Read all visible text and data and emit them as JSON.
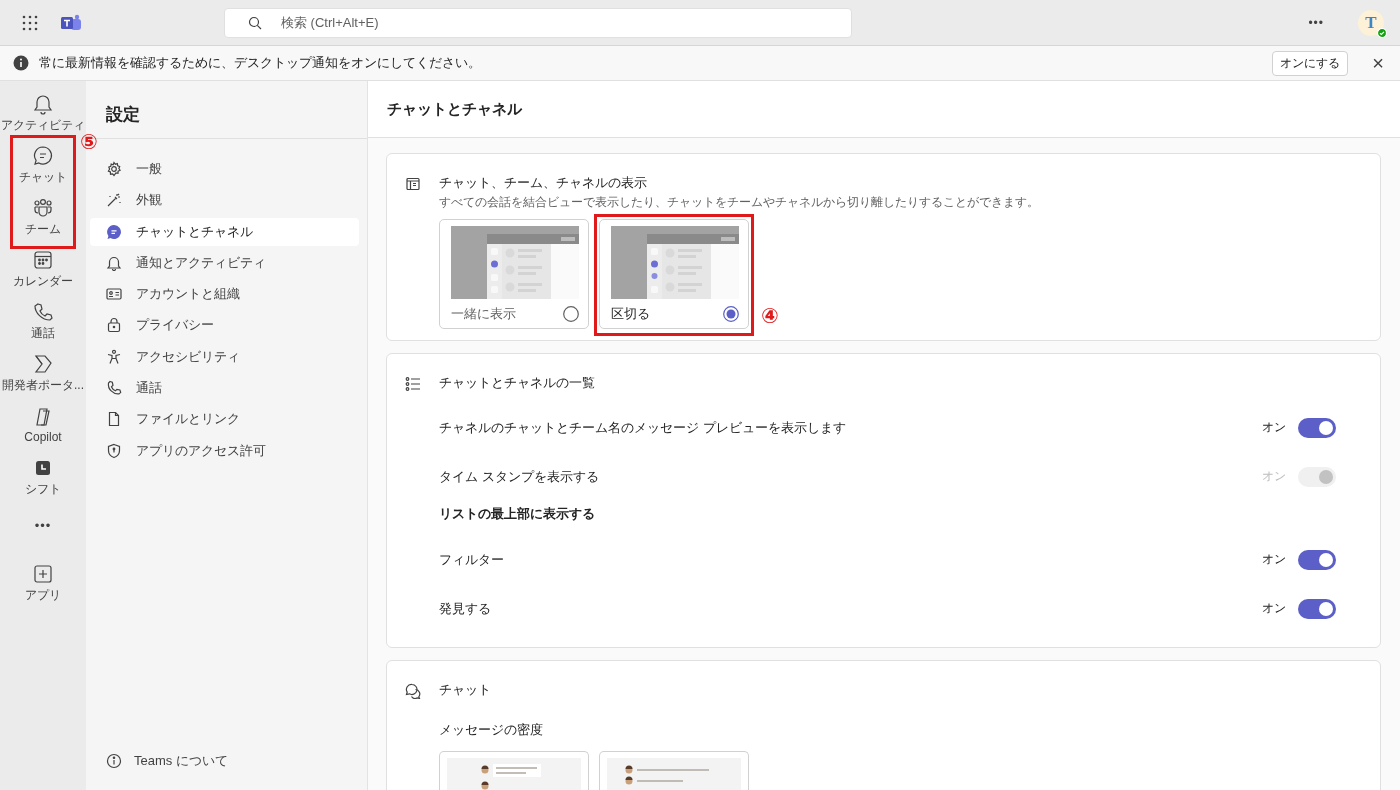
{
  "top_bar": {
    "search": {
      "placeholder": "検索 (Ctrl+Alt+E)"
    },
    "more": "•••",
    "avatar": {
      "initial": "T"
    }
  },
  "banner": {
    "message": "常に最新情報を確認するために、デスクトップ通知をオンにしてください。",
    "button": "オンにする",
    "close": "×"
  },
  "rail": {
    "items": [
      {
        "label": "アクティビティ"
      },
      {
        "label": "チャット",
        "annotated": true
      },
      {
        "label": "チーム",
        "annotated": true
      },
      {
        "label": "カレンダー"
      },
      {
        "label": "通話"
      },
      {
        "label": "開発者ポータ..."
      },
      {
        "label": "Copilot"
      },
      {
        "label": "シフト"
      },
      {
        "label": "•••",
        "kind": "more"
      },
      {
        "label": "アプリ"
      }
    ],
    "annotation_label": "⑤"
  },
  "settings_nav": {
    "title": "設定",
    "items": [
      {
        "label": "一般",
        "selected": false
      },
      {
        "label": "外観",
        "selected": false
      },
      {
        "label": "チャットとチャネル",
        "selected": true
      },
      {
        "label": "通知とアクティビティ",
        "selected": false
      },
      {
        "label": "アカウントと組織",
        "selected": false
      },
      {
        "label": "プライバシー",
        "selected": false
      },
      {
        "label": "アクセシビリティ",
        "selected": false
      },
      {
        "label": "通話",
        "selected": false
      },
      {
        "label": "ファイルとリンク",
        "selected": false
      },
      {
        "label": "アプリのアクセス許可",
        "selected": false
      }
    ],
    "footer": "Teams について"
  },
  "main": {
    "title": "チャットとチャネル",
    "layout_card": {
      "title": "チャット、チーム、チャネルの表示",
      "description": "すべての会話を結合ビューで表示したり、チャットをチームやチャネルから切り離したりすることができます。",
      "options": [
        {
          "label": "一緒に表示",
          "selected": false
        },
        {
          "label": "区切る",
          "selected": true,
          "annotation": "④"
        }
      ]
    },
    "list_card": {
      "title": "チャットとチャネルの一覧",
      "rows": [
        {
          "kind": "toggle",
          "label": "チャネルのチャットとチーム名のメッセージ プレビューを表示します",
          "state_label": "オン",
          "on": true,
          "disabled": false
        },
        {
          "kind": "toggle",
          "label": "タイム スタンプを表示する",
          "state_label": "オン",
          "on": true,
          "disabled": true
        },
        {
          "kind": "heading",
          "label": "リストの最上部に表示する"
        },
        {
          "kind": "toggle",
          "label": "フィルター",
          "state_label": "オン",
          "on": true,
          "disabled": false
        },
        {
          "kind": "toggle",
          "label": "発見する",
          "state_label": "オン",
          "on": true,
          "disabled": false
        }
      ]
    },
    "chat_card": {
      "title": "チャット",
      "subtitle": "メッセージの密度",
      "options": [
        {
          "kind": "comfy"
        },
        {
          "kind": "compact"
        }
      ]
    }
  }
}
